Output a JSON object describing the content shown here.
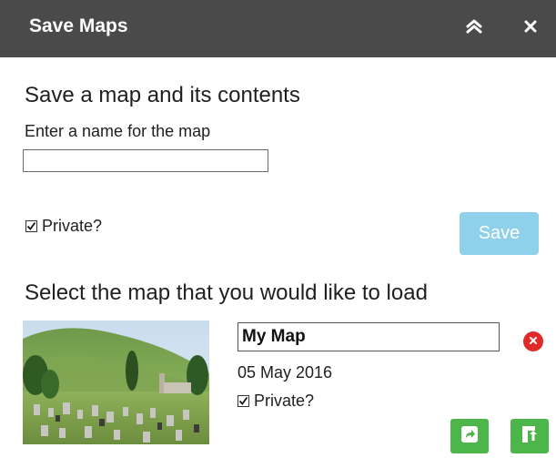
{
  "panel": {
    "title": "Save Maps"
  },
  "save_section": {
    "heading": "Save a map and its contents",
    "name_label": "Enter a name for the map",
    "name_value": "",
    "private_label": "Private?",
    "private_checked": true,
    "save_label": "Save"
  },
  "load_section": {
    "heading": "Select the map that you would like to load",
    "maps": [
      {
        "name": "My Map",
        "date": "05 May 2016",
        "private_label": "Private?",
        "private_checked": true
      }
    ]
  },
  "icons": {
    "collapse": "double-chevron-up-icon",
    "close": "close-icon",
    "delete": "delete-x-icon",
    "share": "share-export-icon",
    "load": "load-file-icon",
    "checkmark": "checkmark-icon"
  },
  "colors": {
    "header_bg": "#4a4a4a",
    "save_button": "#8fd0ea",
    "action_button": "#4cb64a",
    "delete_button": "#e02a2a"
  }
}
